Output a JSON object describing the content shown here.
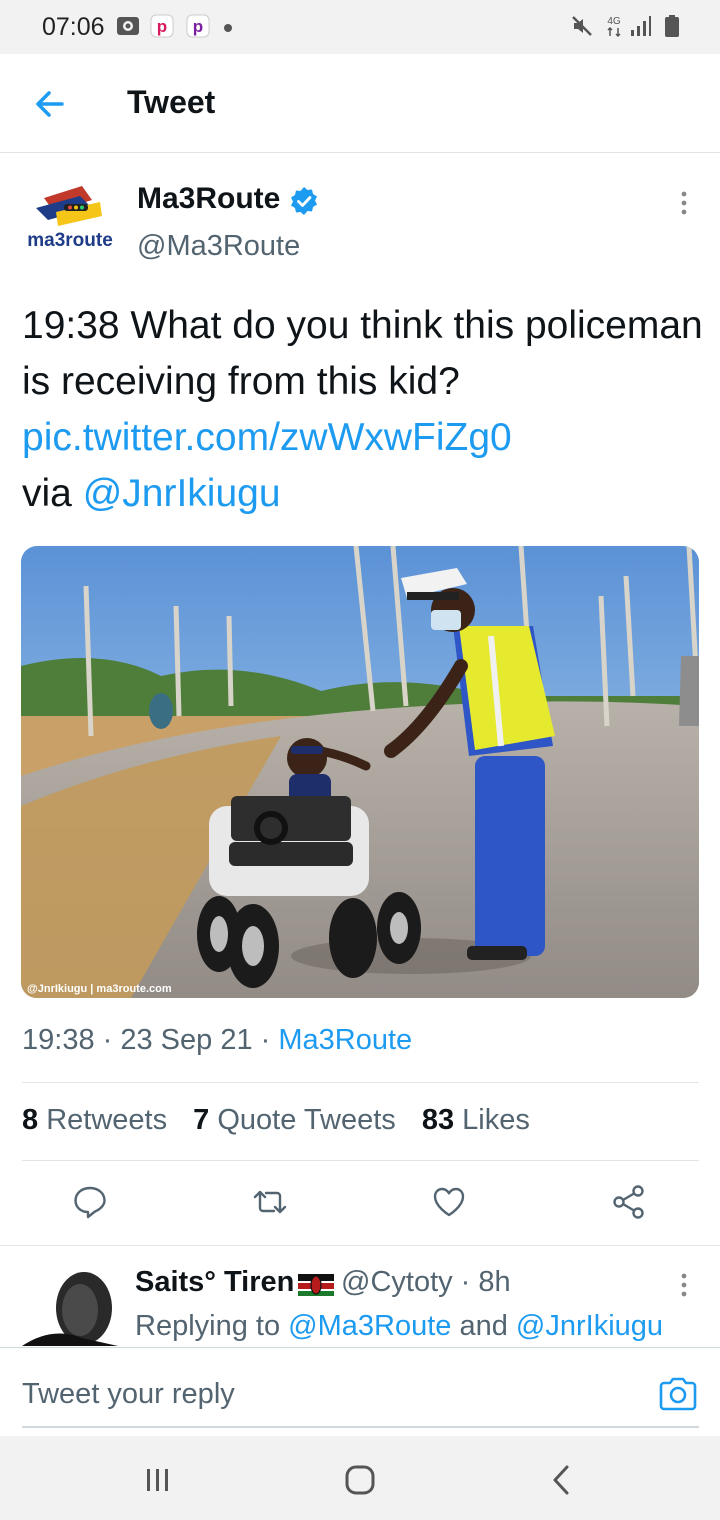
{
  "status_bar": {
    "time": "07:06",
    "left_icons": [
      "gallery-icon",
      "p-app-icon",
      "p-app-icon",
      "dot-icon"
    ],
    "right_icons": [
      "mute-icon",
      "4g-icon",
      "signal-icon",
      "battery-icon"
    ],
    "network_label": "4G"
  },
  "header": {
    "title": "Tweet",
    "back_icon": "arrow-left-icon"
  },
  "tweet": {
    "author_name": "Ma3Route",
    "author_handle": "@Ma3Route",
    "logo_text": "ma3route",
    "text_main": "19:38 What do you think this policeman is receiving from this kid? ",
    "text_link": "pic.twitter.com/zwWxwFiZg0",
    "text_via": "via ",
    "text_mention": "@JnrIkiugu",
    "media_watermark": "@JnrIkiugu | ma3route.com",
    "timestamp": "19:38 · 23 Sep 21 · ",
    "source": "Ma3Route",
    "stats": {
      "retweets_count": "8",
      "retweets_label": "Retweets",
      "quotes_count": "7",
      "quotes_label": "Quote Tweets",
      "likes_count": "83",
      "likes_label": "Likes"
    },
    "actions": [
      "reply-icon",
      "retweet-icon",
      "like-icon",
      "share-icon"
    ]
  },
  "reply": {
    "name": "Saits° Tiren",
    "handle_time": "@Cytoty · 8h",
    "replying_prefix": "Replying to ",
    "replying_user1": "@Ma3Route",
    "replying_and": " and ",
    "replying_user2": "@JnrIkiugu"
  },
  "compose": {
    "placeholder": "Tweet your reply"
  },
  "colors": {
    "accent": "#1d9bf0",
    "text": "#0f1419",
    "secondary": "#536471"
  }
}
